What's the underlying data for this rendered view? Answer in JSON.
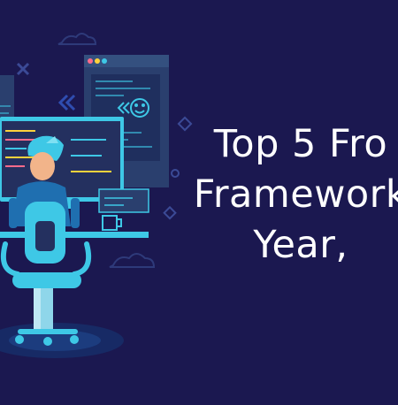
{
  "headline": {
    "lines": [
      "Top 5 Fro",
      "Framework",
      "Year,"
    ]
  },
  "colors": {
    "background": "#1b1850",
    "accent": "#3ec8e6",
    "panel": "#2a3f6e",
    "highlight": "#ffd23c"
  },
  "icons": [
    "developer-illustration",
    "monitor-icon",
    "code-window-icon",
    "smiley-icon",
    "cloud-icon",
    "coffee-mug-icon",
    "office-chair-icon"
  ]
}
